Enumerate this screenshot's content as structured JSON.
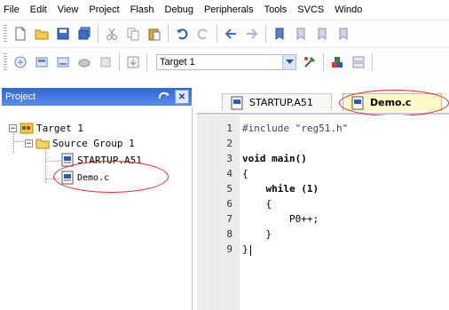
{
  "menu": [
    "File",
    "Edit",
    "View",
    "Project",
    "Flash",
    "Debug",
    "Peripherals",
    "Tools",
    "SVCS",
    "Windo"
  ],
  "toolbar2": {
    "target_value": "Target 1"
  },
  "project_panel": {
    "title": "Project",
    "tree": {
      "root": "Target 1",
      "group": "Source Group 1",
      "files": [
        "STARTUP.A51",
        "Demo.c"
      ]
    }
  },
  "editor": {
    "tabs": [
      {
        "label": "STARTUP.A51",
        "active": false
      },
      {
        "label": "Demo.c",
        "active": true
      }
    ],
    "line_numbers": [
      "1",
      "2",
      "3",
      "4",
      "5",
      "6",
      "7",
      "8",
      "9"
    ],
    "code": [
      "#include \"reg51.h\"",
      "",
      "void main()",
      "{",
      "    while (1)",
      "    {",
      "        P0++;",
      "    }",
      "}"
    ]
  },
  "colors": {
    "panel_header": "#2e66d4",
    "active_tab": "#fff9c8",
    "annotation": "#e22222"
  }
}
